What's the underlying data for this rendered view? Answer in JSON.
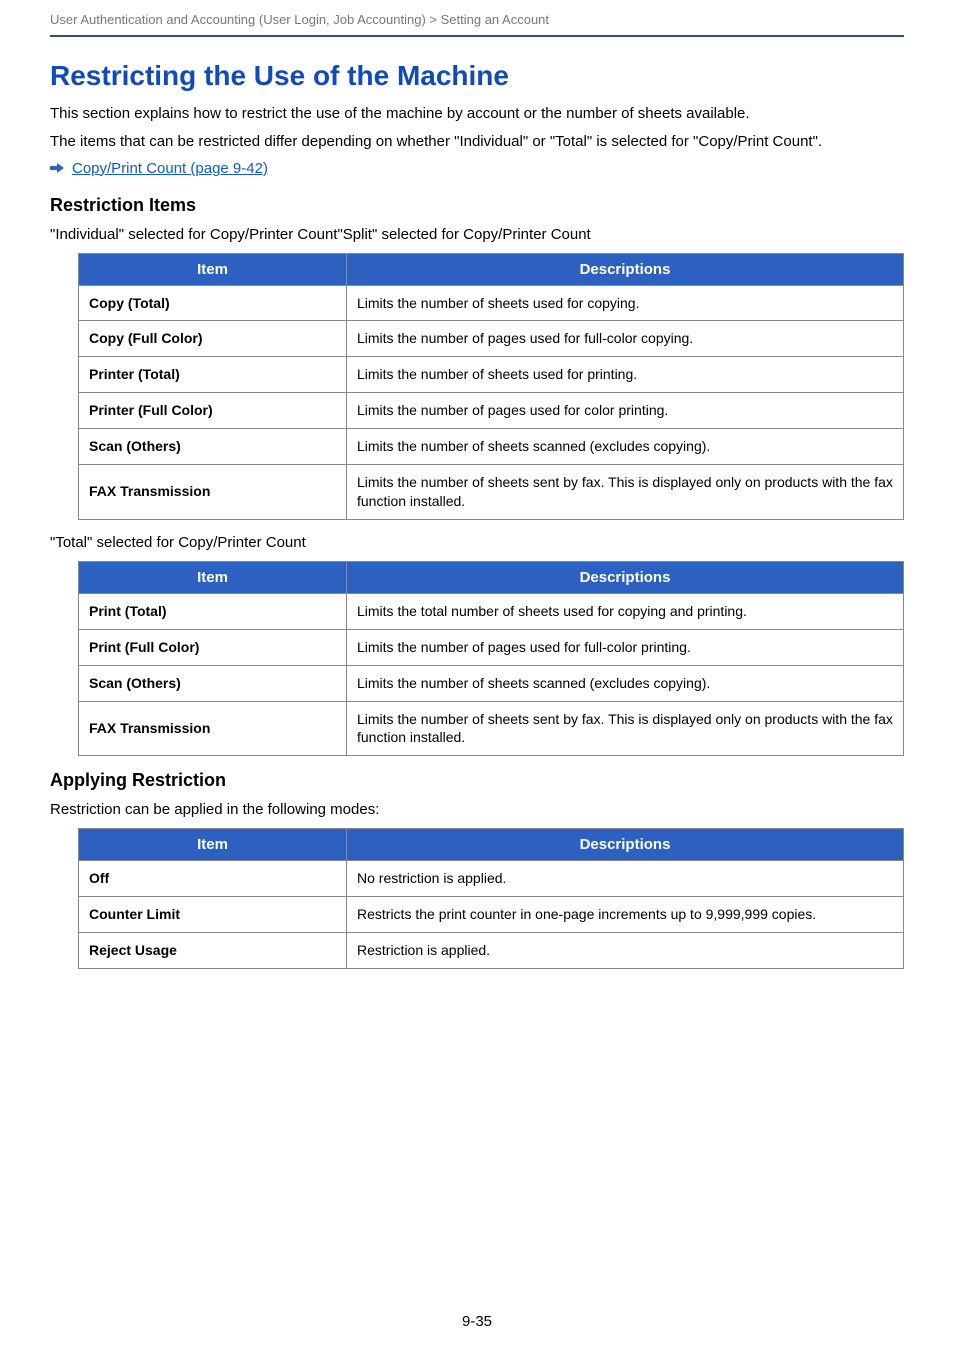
{
  "header": {
    "breadcrumb": "User Authentication and Accounting (User Login, Job Accounting) > Setting an Account"
  },
  "title": "Restricting the Use of the Machine",
  "intro1": "This section explains how to restrict the use of the machine by account or the number of sheets available.",
  "intro2": "The items that can be restricted differ depending on whether \"Individual\" or \"Total\" is selected for \"Copy/Print Count\".",
  "crossref": {
    "icon": "arrow-right-icon",
    "label": "Copy/Print Count (page 9-42)"
  },
  "section1": {
    "heading": "Restriction Items",
    "caption1": "\"Individual\" selected for Copy/Printer Count\"Split\" selected for Copy/Printer Count",
    "table1": {
      "head_item": "Item",
      "head_desc": "Descriptions",
      "rows": [
        {
          "item": "Copy (Total)",
          "desc": "Limits the number of sheets used for copying."
        },
        {
          "item": "Copy (Full Color)",
          "desc": "Limits the number of pages used for full-color copying."
        },
        {
          "item": "Printer (Total)",
          "desc": "Limits the number of sheets used for printing."
        },
        {
          "item": "Printer (Full Color)",
          "desc": "Limits the number of pages used for color printing."
        },
        {
          "item": "Scan (Others)",
          "desc": "Limits the number of sheets scanned (excludes copying)."
        },
        {
          "item": "FAX Transmission",
          "desc": "Limits the number of sheets sent by fax. This is displayed only on products with the fax function installed."
        }
      ]
    },
    "caption2": "\"Total\" selected for Copy/Printer Count",
    "table2": {
      "head_item": "Item",
      "head_desc": "Descriptions",
      "rows": [
        {
          "item": "Print (Total)",
          "desc": "Limits the total number of sheets used for copying and printing."
        },
        {
          "item": "Print (Full Color)",
          "desc": "Limits the number of pages used for full-color printing."
        },
        {
          "item": "Scan (Others)",
          "desc": "Limits the number of sheets scanned (excludes copying)."
        },
        {
          "item": "FAX Transmission",
          "desc": "Limits the number of sheets sent by fax. This is displayed only on products with the fax function installed."
        }
      ]
    }
  },
  "section2": {
    "heading": "Applying Restriction",
    "caption": "Restriction can be applied in the following modes:",
    "table": {
      "head_item": "Item",
      "head_desc": "Descriptions",
      "rows": [
        {
          "item": "Off",
          "desc": "No restriction is applied."
        },
        {
          "item": "Counter Limit",
          "desc": "Restricts the print counter in one-page increments up to 9,999,999 copies."
        },
        {
          "item": "Reject Usage",
          "desc": "Restriction is applied."
        }
      ]
    }
  },
  "footer": {
    "page": "9-35"
  }
}
